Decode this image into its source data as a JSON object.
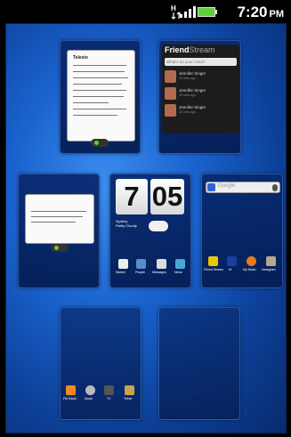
{
  "status_bar": {
    "time": "7:20",
    "ampm": "PM",
    "icons": [
      "data-sync-icon",
      "signal-icon",
      "battery-icon"
    ]
  },
  "panels": {
    "notes_widget": {
      "title": "Teleste"
    },
    "friend_stream": {
      "title": "Friend",
      "title_suffix": "Stream",
      "placeholder": "What's on your mind?",
      "entries": [
        {
          "name": "Jennifer Singer",
          "time": "33 mins ago"
        },
        {
          "name": "Jennifer Singer",
          "time": "33 mins ago"
        },
        {
          "name": "Jennifer Singer",
          "time": "33 mins ago"
        }
      ]
    },
    "clock": {
      "hour": "7",
      "minute": "05",
      "location": "Sydney",
      "condition": "Partly Cloudy",
      "apps": [
        "Market",
        "People",
        "Messages",
        "News"
      ]
    },
    "search": {
      "placeholder": "Google",
      "apps": [
        "Friend Stream",
        "Hi",
        "My Music",
        "Instagram"
      ]
    },
    "bottom_left": {
      "apps": [
        "FM Radio",
        "Music",
        "TV",
        "Tether"
      ]
    }
  },
  "colors": {
    "wallpaper": "#1a63cf",
    "panel": "#082870"
  }
}
